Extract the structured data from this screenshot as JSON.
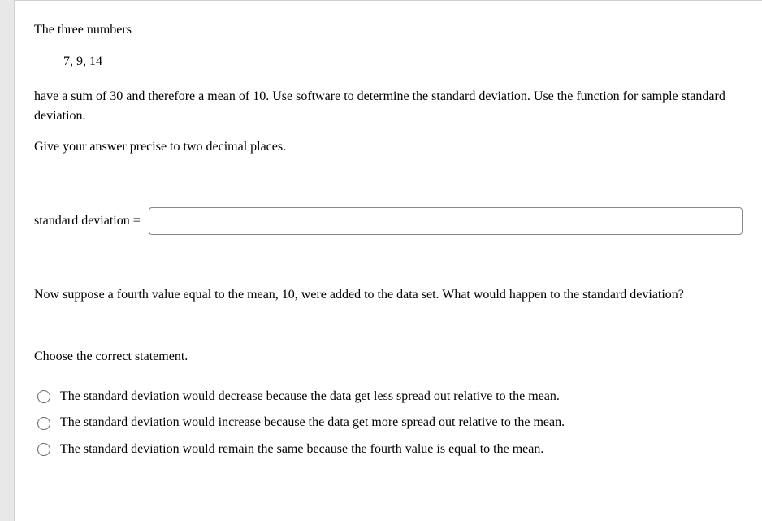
{
  "question": {
    "intro_text": "The three numbers",
    "numbers_display": "7, 9, 14",
    "description": "have a sum of 30 and therefore a mean of 10. Use software to determine the standard deviation. Use the function for sample standard deviation.",
    "precision_note": "Give your answer precise to two decimal places."
  },
  "input": {
    "label": "standard deviation =",
    "value": ""
  },
  "followup": {
    "prompt": "Now suppose a fourth value equal to the mean, 10, were added to the data set. What would happen to the standard deviation?",
    "choose_label": "Choose the correct statement.",
    "options": [
      "The standard deviation would decrease because the data get less spread out relative to the mean.",
      "The standard deviation would increase because the data get more spread out relative to the mean.",
      "The standard deviation would remain the same because the fourth value is equal to the mean."
    ]
  }
}
